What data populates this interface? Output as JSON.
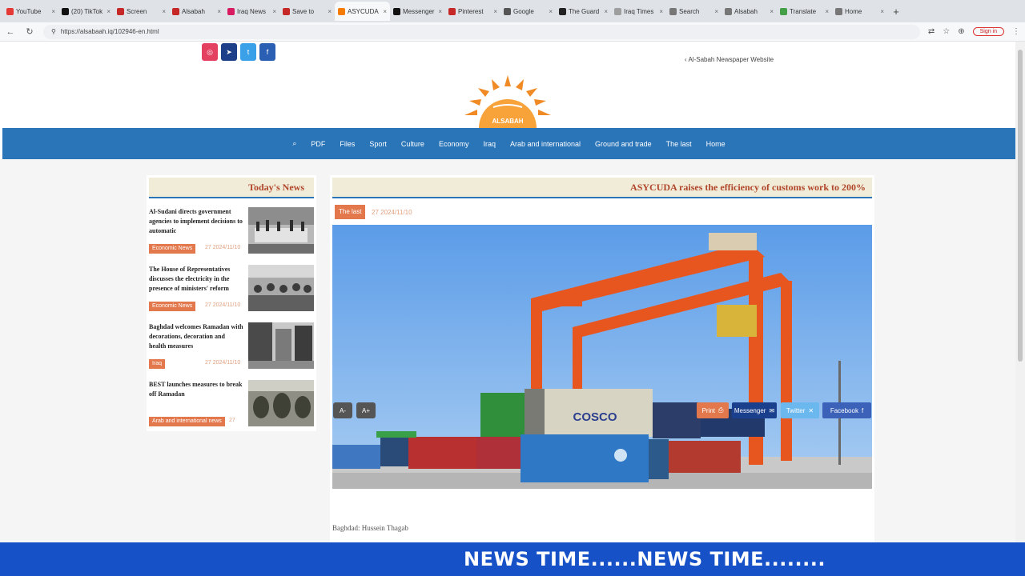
{
  "browser": {
    "tabs": [
      {
        "label": "YouTube",
        "color": "#e53935"
      },
      {
        "label": "(20) TikTok",
        "color": "#111111"
      },
      {
        "label": "Screen",
        "color": "#c62828"
      },
      {
        "label": "Alsabah",
        "color": "#c62828"
      },
      {
        "label": "Iraq News",
        "color": "#d81b60"
      },
      {
        "label": "Save to",
        "color": "#c62828"
      },
      {
        "label": "ASYCUDA",
        "color": "#f57c00"
      },
      {
        "label": "Messenger",
        "color": "#111111"
      },
      {
        "label": "Pinterest",
        "color": "#c62828"
      },
      {
        "label": "Google",
        "color": "#555555"
      },
      {
        "label": "The Guard",
        "color": "#222222"
      },
      {
        "label": "Iraq Times",
        "color": "#9e9e9e"
      },
      {
        "label": "Search",
        "color": "#777777"
      },
      {
        "label": "Alsabah",
        "color": "#777777"
      },
      {
        "label": "Translate",
        "color": "#43a047"
      },
      {
        "label": "Home",
        "color": "#777777"
      }
    ],
    "url": "https://alsabaah.iq/102946-en.html",
    "signin_label": "Sign in"
  },
  "header": {
    "site_link": "Al-Sabah Newspaper Website",
    "logo_text": "ALSABAH",
    "social": [
      {
        "icon": "instagram-icon",
        "glyph": "◎",
        "color": "#e4405f"
      },
      {
        "icon": "telegram-icon",
        "glyph": "➤",
        "color": "#1d3f8a"
      },
      {
        "icon": "twitter-icon",
        "glyph": "t",
        "color": "#3aa0e8"
      },
      {
        "icon": "facebook-icon",
        "glyph": "f",
        "color": "#2b5fb4"
      }
    ]
  },
  "nav": {
    "search_glyph": "⌕",
    "items": [
      "PDF",
      "Files",
      "Sport",
      "Culture",
      "Economy",
      "Iraq",
      "Arab and international",
      "Ground and trade",
      "The last",
      "Home"
    ]
  },
  "sidebar": {
    "title": "Today's News",
    "items": [
      {
        "text": "Al-Sudani directs government agencies to implement decisions to automatic",
        "badge": "Economic News",
        "date": "27 2024/11/10"
      },
      {
        "text": "The House of Representatives discusses the electricity in the presence of ministers' reform",
        "badge": "Economic News",
        "date": "27 2024/11/10"
      },
      {
        "text": "Baghdad welcomes Ramadan with decorations, decoration and health measures",
        "badge": "Iraq",
        "date": "27 2024/11/10"
      },
      {
        "text": "BEST launches measures to break off Ramadan",
        "badge": "Arab and international news",
        "date": "27"
      }
    ]
  },
  "article": {
    "title": "ASYCUDA raises the efficiency of customs work to 200%",
    "category": "The last",
    "date": "27 2024/11/10",
    "font_minus": "A-",
    "font_plus": "A+",
    "author": "Baghdad: Hussein Thagab",
    "container_text": "COSCO",
    "share": {
      "print": "Print",
      "messenger": "Messenger",
      "twitter": "Twitter",
      "facebook": "Facebook"
    }
  },
  "ticker": {
    "text": "NEWS TIME......NEWS TIME........"
  }
}
